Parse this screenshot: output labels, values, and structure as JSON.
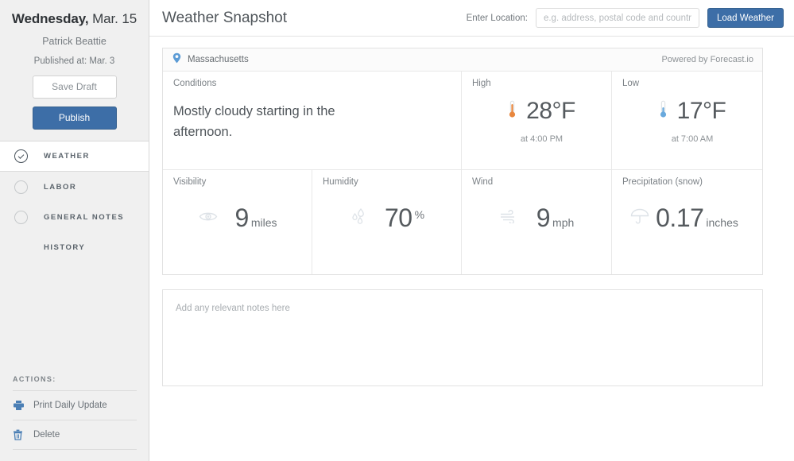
{
  "sidebar": {
    "date_day": "Wednesday,",
    "date_rest": "Mar. 15",
    "author": "Patrick Beattie",
    "published": "Published at: Mar. 3",
    "save_draft_label": "Save Draft",
    "publish_label": "Publish",
    "nav": [
      {
        "label": "WEATHER",
        "state": "checked",
        "active": true
      },
      {
        "label": "LABOR",
        "state": "unchecked",
        "active": false
      },
      {
        "label": "GENERAL NOTES",
        "state": "unchecked",
        "active": false
      },
      {
        "label": "HISTORY",
        "state": "none",
        "active": false
      }
    ],
    "actions_title": "ACTIONS:",
    "actions": [
      {
        "label": "Print Daily Update",
        "icon": "printer-icon"
      },
      {
        "label": "Delete",
        "icon": "trash-icon"
      }
    ]
  },
  "header": {
    "title": "Weather Snapshot",
    "location_label": "Enter Location:",
    "location_placeholder": "e.g. address, postal code and country",
    "location_value": "",
    "load_button": "Load Weather"
  },
  "weather_card": {
    "location": "Massachusetts",
    "powered_by": "Powered by Forecast.io",
    "conditions": {
      "label": "Conditions",
      "text": "Mostly cloudy starting in the afternoon."
    },
    "high": {
      "label": "High",
      "value": "28°F",
      "time": "at 4:00 PM",
      "icon": "thermometer-hot-icon",
      "color": "#e8873e"
    },
    "low": {
      "label": "Low",
      "value": "17°F",
      "time": "at 7:00 AM",
      "icon": "thermometer-cold-icon",
      "color": "#69a9dd"
    },
    "visibility": {
      "label": "Visibility",
      "value": "9",
      "unit": "miles",
      "icon": "eye-icon"
    },
    "humidity": {
      "label": "Humidity",
      "value": "70",
      "unit": "%",
      "icon": "droplets-icon"
    },
    "wind": {
      "label": "Wind",
      "value": "9",
      "unit": "mph",
      "icon": "wind-icon"
    },
    "precipitation": {
      "label": "Precipitation (snow)",
      "value": "0.17",
      "unit": "inches",
      "icon": "umbrella-icon"
    }
  },
  "notes": {
    "placeholder": "Add any relevant notes here",
    "value": ""
  },
  "colors": {
    "primary_blue": "#3d6ea7",
    "pin_blue": "#5b9bd5",
    "sidebar_bg": "#f0f0f0",
    "text": "#555a5e"
  }
}
